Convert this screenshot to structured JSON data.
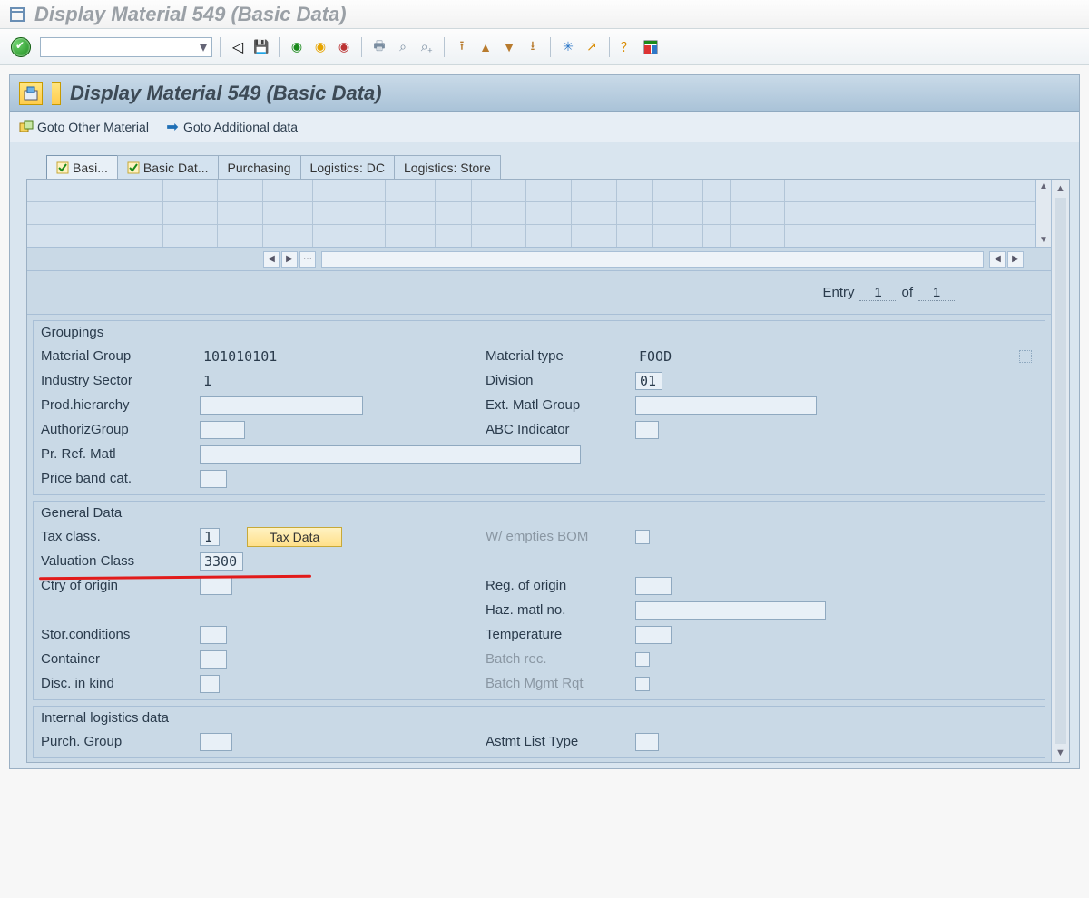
{
  "window": {
    "title": "Display Material 549 (Basic Data)"
  },
  "toolbar_icons": {
    "save": "💾",
    "printpre": "🖨",
    "find": "🔍",
    "findnext": "🔎",
    "firstpage": "⏮",
    "prevpage": "◀",
    "nextpage": "▶",
    "lastpage": "⏭",
    "create": "✳",
    "change": "↗",
    "help": "❓",
    "layout": "▤"
  },
  "header": {
    "title": "Display Material 549 (Basic Data)"
  },
  "app_toolbar": {
    "goto_other_material": "Goto Other Material",
    "goto_additional_data": "Goto Additional data"
  },
  "tabs": {
    "items": [
      {
        "label": "Basi...",
        "active": true,
        "tick": true
      },
      {
        "label": "Basic Dat...",
        "active": false,
        "tick": true
      },
      {
        "label": "Purchasing",
        "active": false,
        "tick": false
      },
      {
        "label": "Logistics: DC",
        "active": false,
        "tick": false
      },
      {
        "label": "Logistics: Store",
        "active": false,
        "tick": false
      }
    ]
  },
  "entry": {
    "label": "Entry",
    "cur": "1",
    "of_label": "of",
    "tot": "1"
  },
  "groupings": {
    "title": "Groupings",
    "left": {
      "material_group": {
        "label": "Material Group",
        "value": "101010101"
      },
      "industry_sector": {
        "label": "Industry Sector",
        "value": "1"
      },
      "prod_hierarchy": {
        "label": "Prod.hierarchy",
        "value": ""
      },
      "authoriz_group": {
        "label": "AuthorizGroup",
        "value": ""
      },
      "pr_ref_matl": {
        "label": "Pr. Ref. Matl",
        "value": ""
      },
      "price_band_cat": {
        "label": "Price band cat.",
        "value": ""
      }
    },
    "right": {
      "material_type": {
        "label": "Material type",
        "value": "FOOD"
      },
      "division": {
        "label": "Division",
        "value": "01"
      },
      "ext_matl_group": {
        "label": "Ext. Matl Group",
        "value": ""
      },
      "abc_indicator": {
        "label": "ABC Indicator",
        "value": ""
      }
    }
  },
  "general": {
    "title": "General Data",
    "left": {
      "tax_class": {
        "label": "Tax class.",
        "value": "1"
      },
      "tax_data_btn": "Tax Data",
      "valuation_class": {
        "label": "Valuation Class",
        "value": "3300"
      },
      "ctry_origin": {
        "label": "Ctry of origin",
        "value": ""
      },
      "stor_conditions": {
        "label": "Stor.conditions",
        "value": ""
      },
      "container": {
        "label": "Container",
        "value": ""
      },
      "disc_in_kind": {
        "label": "Disc. in kind",
        "value": ""
      }
    },
    "right": {
      "w_empties_bom": {
        "label": "W/ empties BOM"
      },
      "reg_origin": {
        "label": "Reg. of origin",
        "value": ""
      },
      "haz_matl_no": {
        "label": "Haz. matl no.",
        "value": ""
      },
      "temperature": {
        "label": "Temperature",
        "value": ""
      },
      "batch_rec": {
        "label": "Batch rec."
      },
      "batch_mgmt": {
        "label": "Batch Mgmt Rqt"
      }
    }
  },
  "internal": {
    "title": "Internal logistics data",
    "left": {
      "purch_group": {
        "label": "Purch. Group",
        "value": ""
      }
    },
    "right": {
      "astmt_list_type": {
        "label": "Astmt List Type",
        "value": ""
      }
    }
  }
}
